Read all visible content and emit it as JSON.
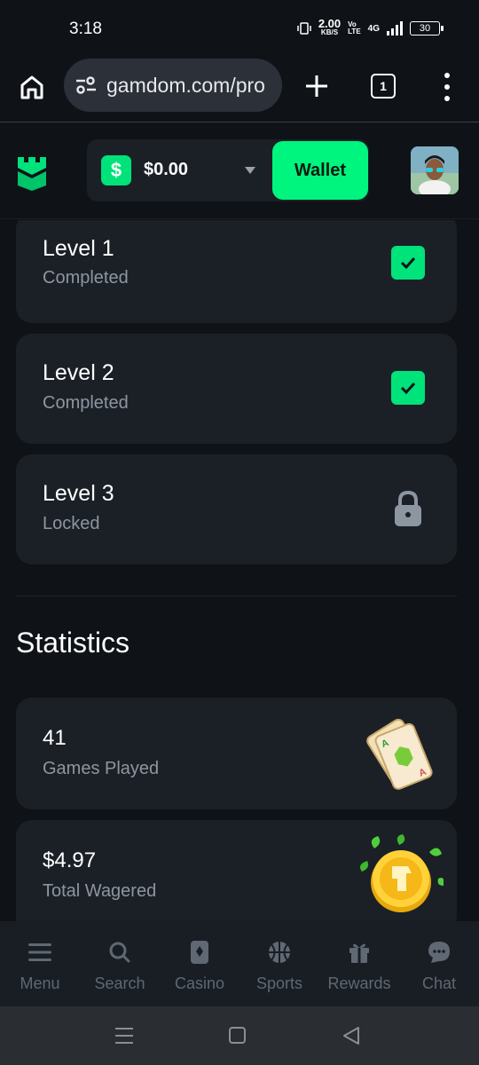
{
  "status_bar": {
    "time": "3:18",
    "net_speed": "2.00",
    "net_unit": "KB/S",
    "volte_top": "Vo",
    "volte_bottom": "LTE",
    "network": "4G",
    "battery": "30"
  },
  "browser": {
    "url": "gamdom.com/pro",
    "tab_count": "1"
  },
  "header": {
    "balance": "$0.00",
    "currency_symbol": "$",
    "wallet_label": "Wallet",
    "accent_color": "#00f57e"
  },
  "levels": [
    {
      "title": "Level 1",
      "status": "Completed",
      "state": "completed"
    },
    {
      "title": "Level 2",
      "status": "Completed",
      "state": "completed"
    },
    {
      "title": "Level 3",
      "status": "Locked",
      "state": "locked"
    }
  ],
  "statistics": {
    "title": "Statistics",
    "items": [
      {
        "value": "41",
        "label": "Games Played",
        "icon": "playing-cards-icon"
      },
      {
        "value": "$4.97",
        "label": "Total Wagered",
        "icon": "gold-coin-icon"
      }
    ]
  },
  "bottom_nav": [
    {
      "label": "Menu",
      "icon": "menu-icon"
    },
    {
      "label": "Search",
      "icon": "search-icon"
    },
    {
      "label": "Casino",
      "icon": "casino-icon"
    },
    {
      "label": "Sports",
      "icon": "basketball-icon"
    },
    {
      "label": "Rewards",
      "icon": "gift-icon"
    },
    {
      "label": "Chat",
      "icon": "chat-icon"
    }
  ]
}
